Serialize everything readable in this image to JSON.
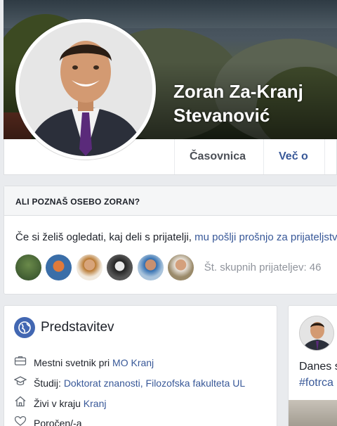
{
  "profile": {
    "name_line1": "Zoran Za-Kranj",
    "name_line2": "Stevanović"
  },
  "tabs": {
    "timeline": "Časovnica",
    "more": "Več o"
  },
  "know": {
    "heading": "ALI POZNAŠ OSEBO ZORAN?",
    "text": "Če si želiš ogledati, kaj deli s prijatelji, ",
    "link": "mu pošlji prošnjo za prijateljstvo.",
    "mutual": "Št. skupnih prijateljev: 46"
  },
  "intro": {
    "title": "Predstavitev",
    "work_prefix": "Mestni svetnik pri ",
    "work_link": "MO Kranj",
    "study_prefix": "Študij: ",
    "study_link": "Doktorat znanosti, Filozofska fakulteta UL",
    "live_prefix": "Živi v kraju ",
    "live_link": "Kranj",
    "relationship": "Poročen/-a"
  },
  "post": {
    "line1": "Danes s",
    "line2": "#fotrca"
  },
  "icons": [
    "globe-icon",
    "briefcase-icon",
    "graduation-cap-icon",
    "home-icon",
    "heart-icon"
  ],
  "colors": {
    "link": "#385898",
    "accent": "#4267b2",
    "background": "#e9ebee"
  }
}
